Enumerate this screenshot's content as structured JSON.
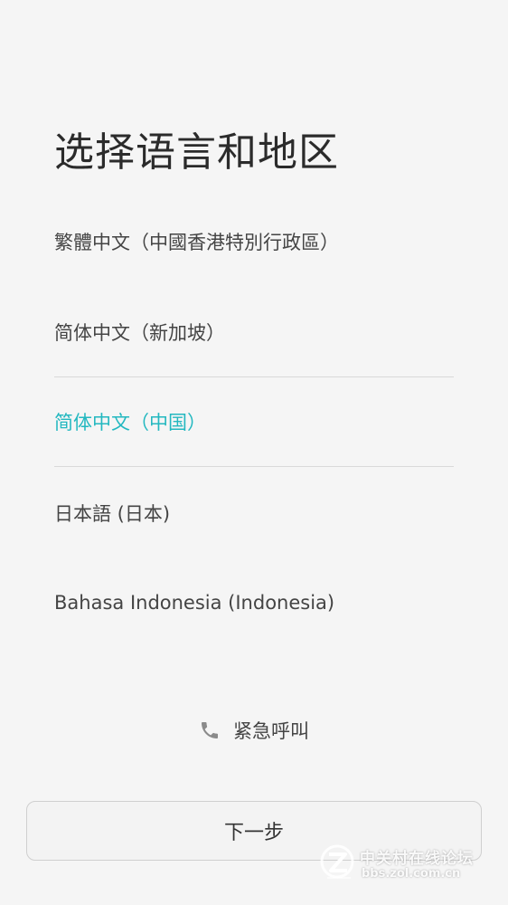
{
  "page": {
    "title": "选择语言和地区"
  },
  "languages": [
    {
      "label": "繁體中文（中國香港特別行政區）",
      "selected": false
    },
    {
      "label": "简体中文（新加坡）",
      "selected": false
    },
    {
      "label": "简体中文（中国）",
      "selected": true
    },
    {
      "label": "日本語 (日本)",
      "selected": false
    },
    {
      "label": "Bahasa Indonesia (Indonesia)",
      "selected": false
    }
  ],
  "emergency": {
    "icon": "phone-icon",
    "label": "紧急呼叫"
  },
  "footer": {
    "next_label": "下一步"
  },
  "watermark": {
    "site_name": "中关村在线论坛",
    "url": "bbs.zol.com.cn"
  },
  "colors": {
    "background": "#f5f5f5",
    "accent": "#23b8c0",
    "text": "#444444"
  }
}
